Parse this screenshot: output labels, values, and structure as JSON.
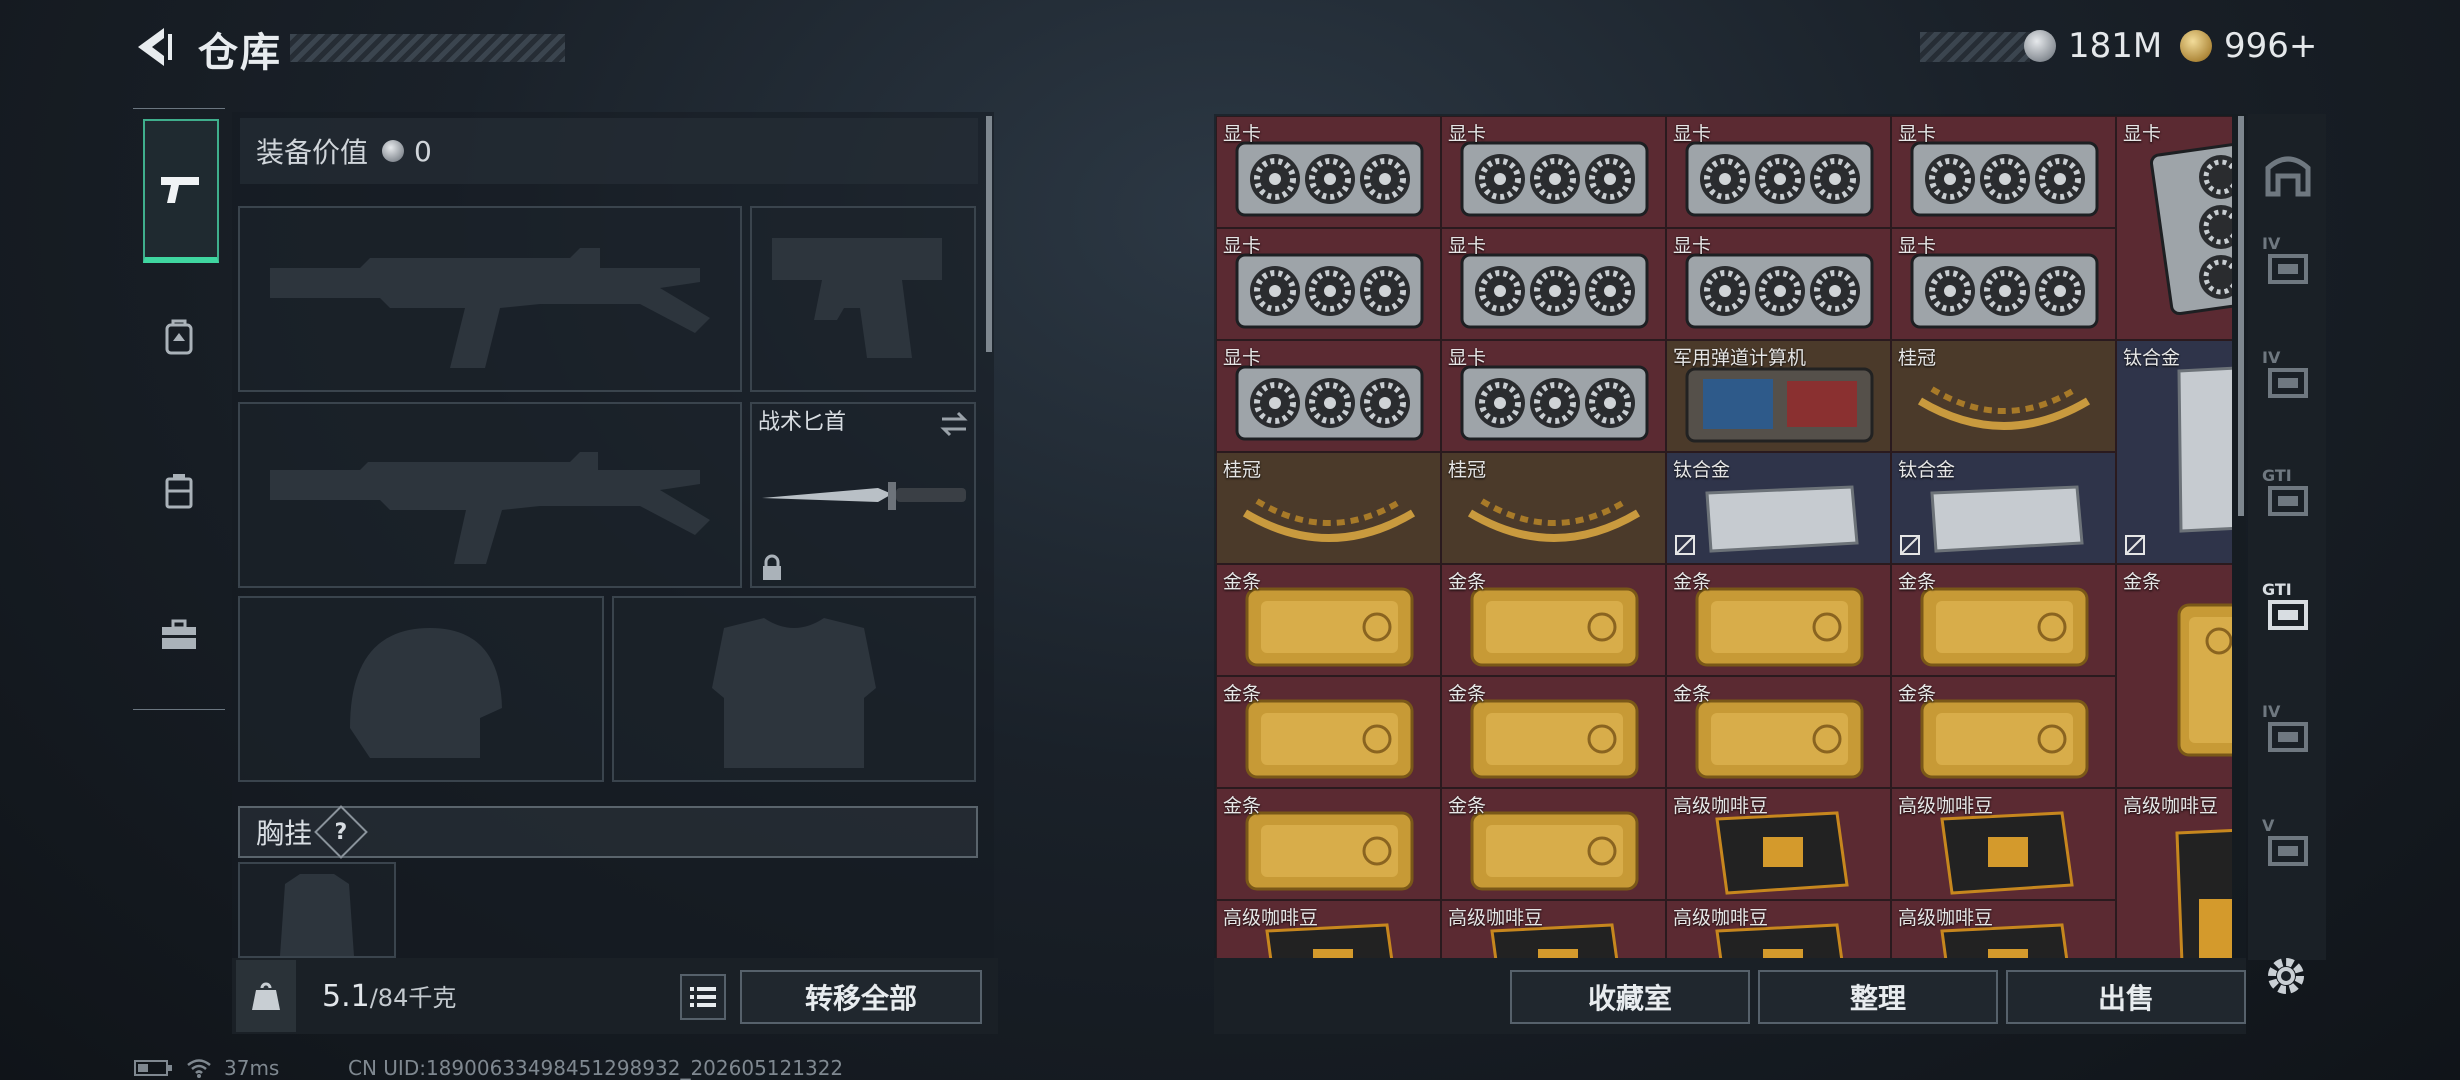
{
  "header": {
    "title": "仓库",
    "currency_silver": "181M",
    "currency_gold": "996+"
  },
  "left_tabs": [
    {
      "name": "weapons",
      "icon": "pistol-icon"
    },
    {
      "name": "backpack",
      "icon": "backpack-icon"
    },
    {
      "name": "bag",
      "icon": "bag-icon"
    },
    {
      "name": "medkit",
      "icon": "toolbox-icon"
    }
  ],
  "equipment": {
    "value_label": "装备价值",
    "value": "0",
    "knife_label": "战术匕首",
    "chest_label": "胸挂",
    "chest_help": "?"
  },
  "capacity": {
    "current": "5.1",
    "max_unit": "/84千克",
    "transfer_all": "转移全部"
  },
  "inventory": {
    "cells": [
      {
        "label": "显卡",
        "item": "gpu",
        "bg": "red"
      },
      {
        "label": "显卡",
        "item": "gpu",
        "bg": "red"
      },
      {
        "label": "显卡",
        "item": "gpu",
        "bg": "red"
      },
      {
        "label": "显卡",
        "item": "gpu",
        "bg": "red"
      },
      {
        "label": "显卡",
        "item": "gpu-vertical",
        "bg": "red"
      },
      {
        "label": "显卡",
        "item": "gpu",
        "bg": "red"
      },
      {
        "label": "显卡",
        "item": "gpu",
        "bg": "red"
      },
      {
        "label": "显卡",
        "item": "gpu",
        "bg": "red"
      },
      {
        "label": "显卡",
        "item": "gpu",
        "bg": "red"
      },
      {
        "label": "显卡",
        "item": "gpu",
        "bg": "red"
      },
      {
        "label": "显卡",
        "item": "gpu",
        "bg": "red"
      },
      {
        "label": "军用弹道计算机",
        "item": "computer",
        "bg": "brown"
      },
      {
        "label": "桂冠",
        "item": "laurel",
        "bg": "brown"
      },
      {
        "label": "钛合金",
        "item": "ti-vertical",
        "bg": "blue"
      },
      {
        "label": "桂冠",
        "item": "laurel",
        "bg": "brown"
      },
      {
        "label": "桂冠",
        "item": "laurel",
        "bg": "brown"
      },
      {
        "label": "钛合金",
        "item": "ti",
        "bg": "blue"
      },
      {
        "label": "钛合金",
        "item": "ti",
        "bg": "blue"
      },
      {
        "label": "金条",
        "item": "gold",
        "bg": "red"
      },
      {
        "label": "金条",
        "item": "gold",
        "bg": "red"
      },
      {
        "label": "金条",
        "item": "gold",
        "bg": "red"
      },
      {
        "label": "金条",
        "item": "gold",
        "bg": "red"
      },
      {
        "label": "金条",
        "item": "gold-vertical",
        "bg": "red"
      },
      {
        "label": "金条",
        "item": "gold",
        "bg": "red"
      },
      {
        "label": "金条",
        "item": "gold",
        "bg": "red"
      },
      {
        "label": "金条",
        "item": "gold",
        "bg": "red"
      },
      {
        "label": "金条",
        "item": "gold",
        "bg": "red"
      },
      {
        "label": "金条",
        "item": "gold",
        "bg": "red"
      },
      {
        "label": "金条",
        "item": "gold",
        "bg": "red"
      },
      {
        "label": "高级咖啡豆",
        "item": "coffee",
        "bg": "red"
      },
      {
        "label": "高级咖啡豆",
        "item": "coffee",
        "bg": "red"
      },
      {
        "label": "高级咖啡豆",
        "item": "coffee-vertical",
        "bg": "red"
      },
      {
        "label": "高级咖啡豆",
        "item": "coffee",
        "bg": "red"
      },
      {
        "label": "高级咖啡豆",
        "item": "coffee",
        "bg": "red"
      },
      {
        "label": "高级咖啡豆",
        "item": "coffee",
        "bg": "red"
      },
      {
        "label": "高级咖啡豆",
        "item": "coffee",
        "bg": "red"
      }
    ]
  },
  "right_tabs": [
    {
      "label": "",
      "icon": "home-icon"
    },
    {
      "label": "IV",
      "icon": "storage-iv-1-icon"
    },
    {
      "label": "IV",
      "icon": "storage-iv-2-icon"
    },
    {
      "label": "GTI",
      "icon": "storage-gti-1-icon"
    },
    {
      "label": "GTI",
      "icon": "storage-gti-2-icon"
    },
    {
      "label": "IV",
      "icon": "storage-iv-3-icon"
    },
    {
      "label": "V",
      "icon": "storage-v-icon"
    }
  ],
  "actions": {
    "collection": "收藏室",
    "sort": "整理",
    "sell": "出售"
  },
  "status_bar": {
    "ping": "37ms",
    "uid": "CN UID:18900633498451298932_202605121322"
  }
}
